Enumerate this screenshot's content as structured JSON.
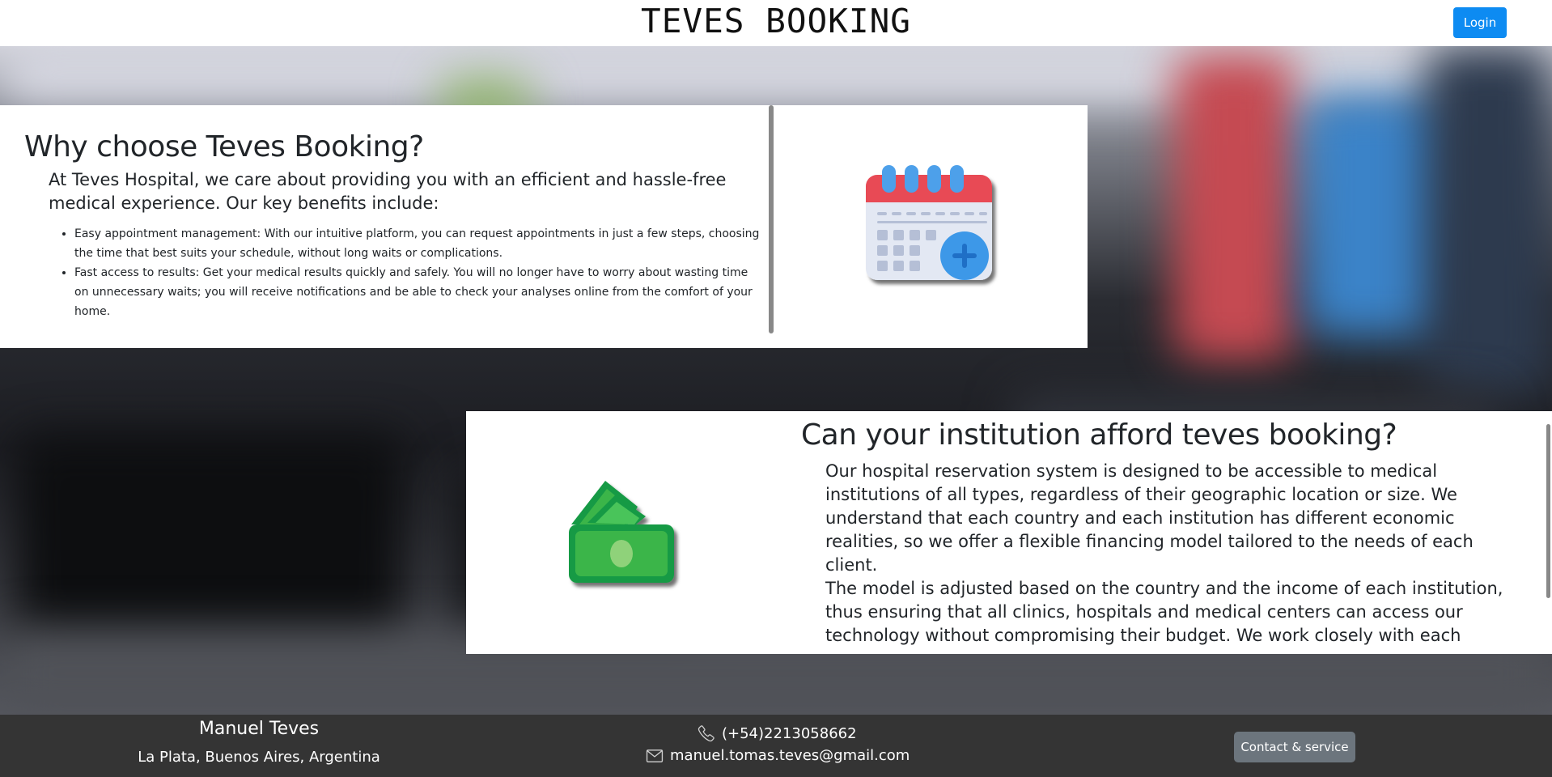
{
  "header": {
    "brand": "TEVES BOOKING",
    "login_label": "Login"
  },
  "why": {
    "title": "Why choose Teves Booking?",
    "intro": "At Teves Hospital, we care about providing you with an efficient and hassle-free medical experience. Our key benefits include:",
    "benefits": [
      "Easy appointment management: With our intuitive platform, you can request appointments in just a few steps, choosing the time that best suits your schedule, without long waits or complications.",
      "Fast access to results: Get your medical results quickly and safely. You will no longer have to worry about wasting time on unnecessary waits; you will receive notifications and be able to check your analyses online from the comfort of your home."
    ],
    "image_icon": "calendar-add-icon"
  },
  "afford": {
    "title": "Can your institution afford teves booking?",
    "paragraphs": [
      "Our hospital reservation system is designed to be accessible to medical institutions of all types, regardless of their geographic location or size. We understand that each country and each institution has different economic realities, so we offer a flexible financing model tailored to the needs of each client.",
      "The model is adjusted based on the country and the income of each institution, thus ensuring that all clinics, hospitals and medical centers can access our technology without compromising their budget. We work closely with each"
    ],
    "image_icon": "money-icon"
  },
  "footer": {
    "name": "Manuel Teves",
    "location": "La Plata, Buenos Aires, Argentina",
    "phone": "(+54)2213058662",
    "email": "manuel.tomas.teves@gmail.com",
    "contact_label": "Contact & service",
    "phone_icon": "phone-icon",
    "email_icon": "mail-icon"
  },
  "colors": {
    "primary": "#0d8bf2",
    "secondary": "#6c757d",
    "footer_bg": "#343434",
    "calendar_red": "#e84a55",
    "money_green": "#3bb54a"
  }
}
